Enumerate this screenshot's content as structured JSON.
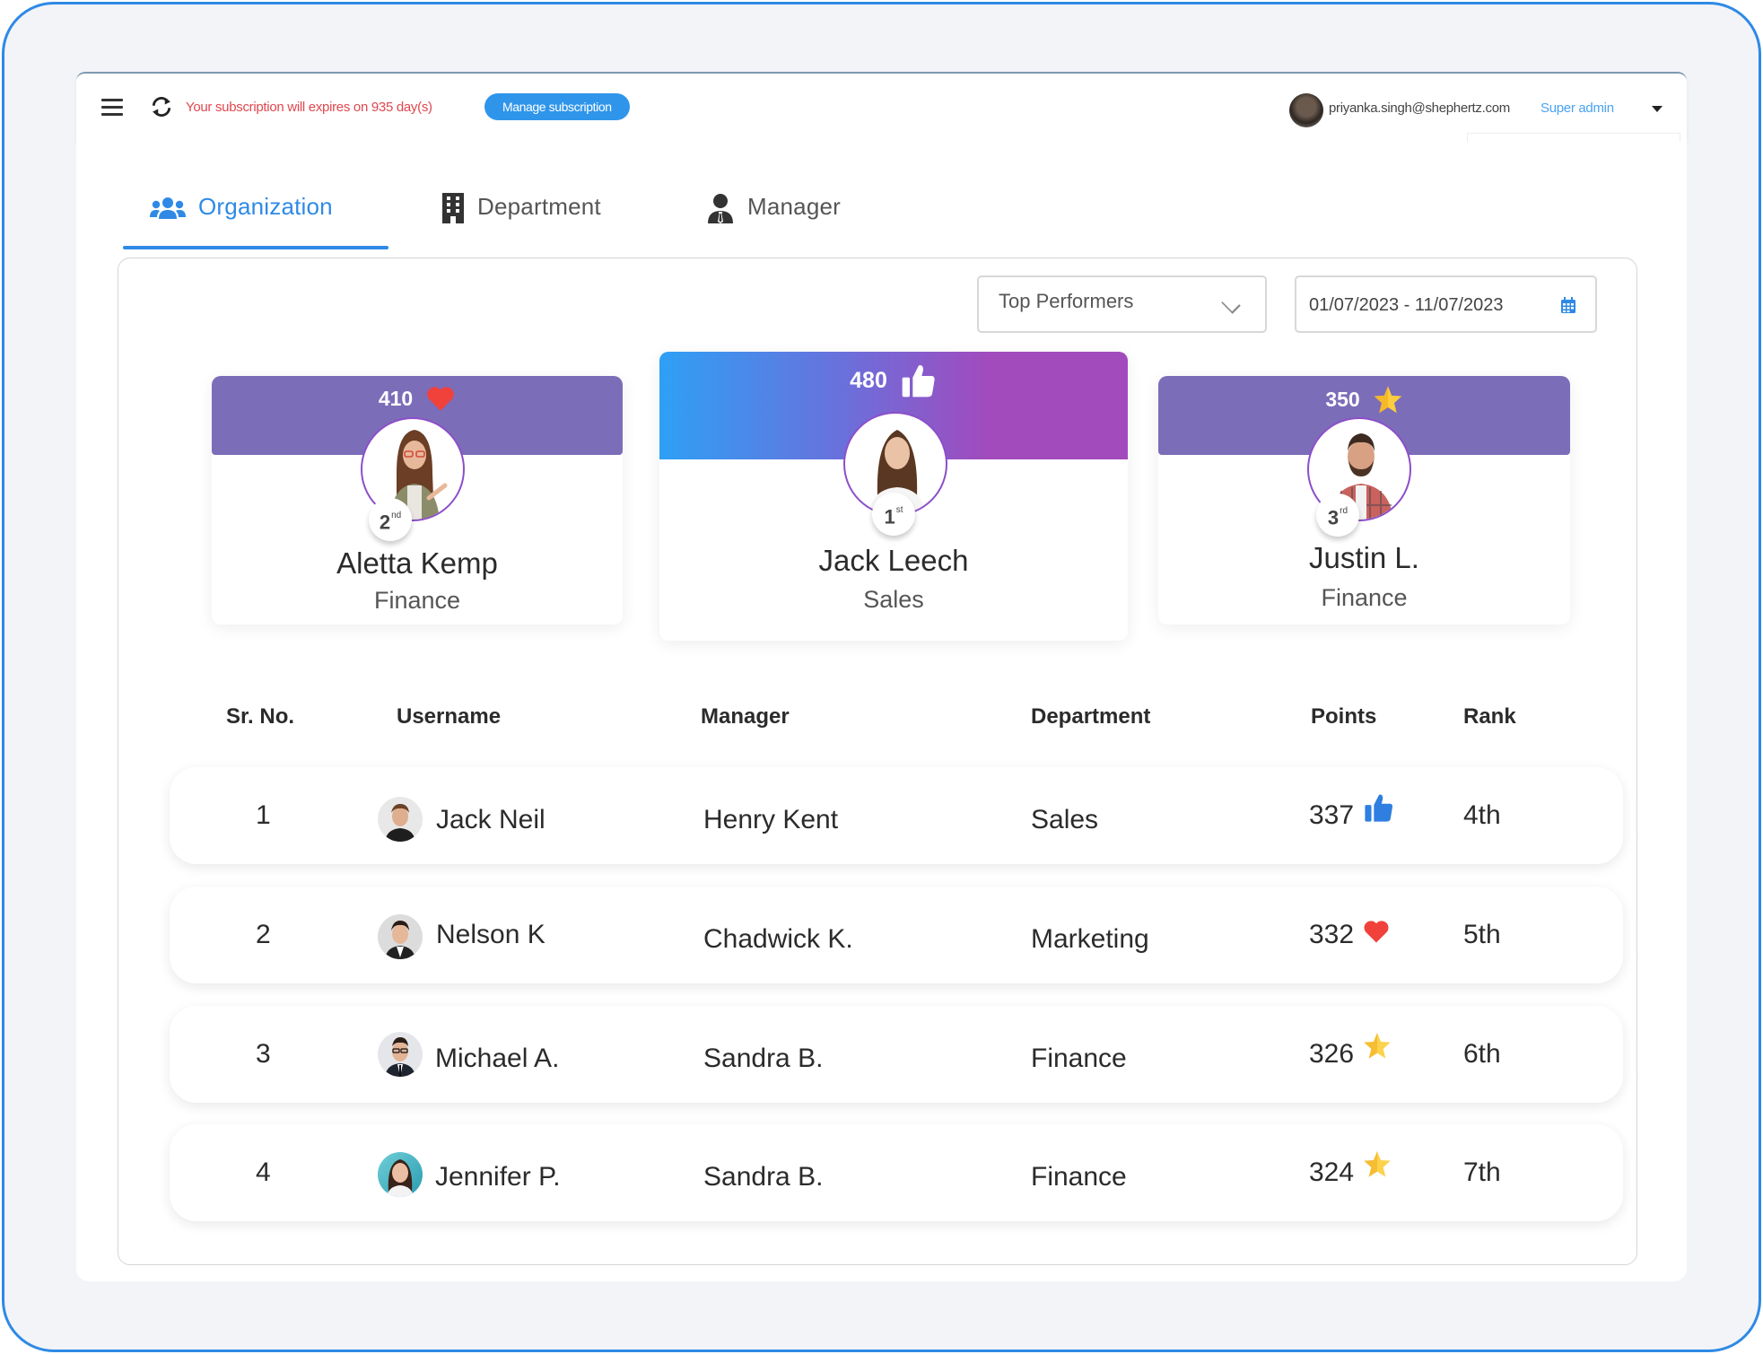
{
  "header": {
    "menu_icon": "hamburger-menu-icon",
    "refresh_icon": "refresh-icon",
    "subscription_notice": "Your subscription will expires on 935 day(s)",
    "manage_subscription_label": "Manage subscription",
    "user_email": "priyanka.singh@shephertz.com",
    "user_role": "Super admin",
    "user_menu_icon": "caret-down-icon"
  },
  "tabs": [
    {
      "label": "Organization",
      "icon": "users-group-icon",
      "active": true
    },
    {
      "label": "Department",
      "icon": "building-icon",
      "active": false
    },
    {
      "label": "Manager",
      "icon": "manager-icon",
      "active": false
    }
  ],
  "filters": {
    "category_select": {
      "value": "Top Performers",
      "icon": "chevron-down-icon"
    },
    "date_range": {
      "value": "01/07/2023 - 11/07/2023",
      "icon": "calendar-icon"
    }
  },
  "colors": {
    "accent": "#2e8ae6",
    "podium_banner": "#7c6db9",
    "winner_gradient_start": "#2ea0f5",
    "winner_gradient_end": "#a14bbd",
    "heart": "#f0413b",
    "star": "#fdcd3e",
    "thumb": "#2e7fe0",
    "subscription_warning": "#e0474f"
  },
  "podium": [
    {
      "place": "2",
      "suffix": "nd",
      "points": "410",
      "icon": "heart-icon",
      "name": "Aletta Kemp",
      "department": "Finance"
    },
    {
      "place": "1",
      "suffix": "st",
      "points": "480",
      "icon": "thumbs-up-icon",
      "name": "Jack Leech",
      "department": "Sales"
    },
    {
      "place": "3",
      "suffix": "rd",
      "points": "350",
      "icon": "star-icon",
      "name": "Justin L.",
      "department": "Finance"
    }
  ],
  "table": {
    "headers": [
      "Sr. No.",
      "Username",
      "Manager",
      "Department",
      "Points",
      "Rank"
    ],
    "rows": [
      {
        "sr": "1",
        "username": "Jack Neil",
        "manager": "Henry Kent",
        "department": "Sales",
        "points": "337",
        "icon": "thumbs-up-icon",
        "rank": "4th"
      },
      {
        "sr": "2",
        "username": "Nelson K",
        "manager": "Chadwick K.",
        "department": "Marketing",
        "points": "332",
        "icon": "heart-icon",
        "rank": "5th"
      },
      {
        "sr": "3",
        "username": "Michael A.",
        "manager": "Sandra B.",
        "department": "Finance",
        "points": "326",
        "icon": "star-icon",
        "rank": "6th"
      },
      {
        "sr": "4",
        "username": "Jennifer P.",
        "manager": "Sandra B.",
        "department": "Finance",
        "points": "324",
        "icon": "star-icon",
        "rank": "7th"
      }
    ]
  }
}
